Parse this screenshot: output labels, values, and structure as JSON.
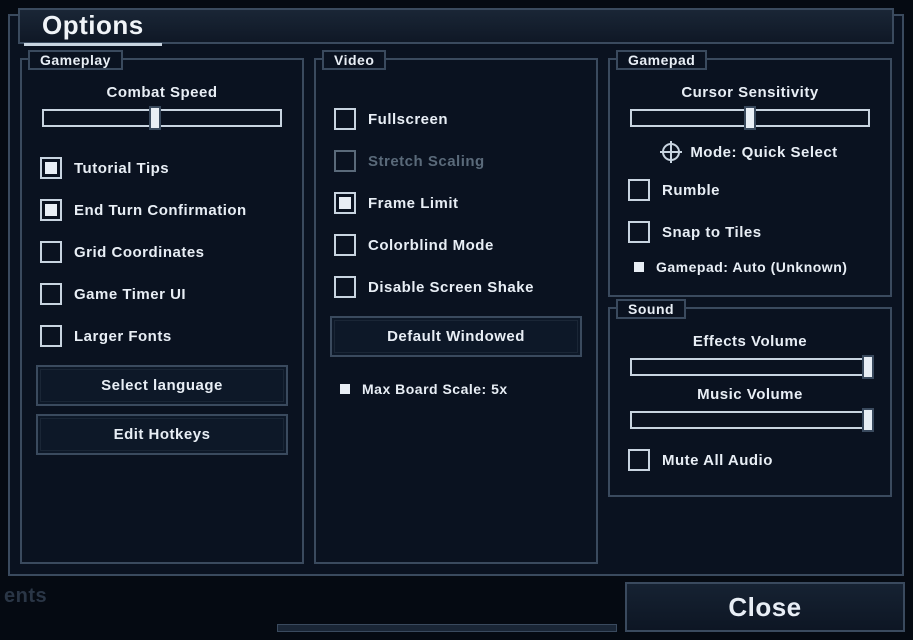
{
  "title": "Options",
  "gameplay": {
    "legend": "Gameplay",
    "combat_speed": {
      "label": "Combat Speed",
      "value": 47
    },
    "tutorial_tips": {
      "label": "Tutorial Tips",
      "checked": true
    },
    "end_turn_confirm": {
      "label": "End Turn Confirmation",
      "checked": true
    },
    "grid_coords": {
      "label": "Grid Coordinates",
      "checked": false
    },
    "game_timer": {
      "label": "Game Timer UI",
      "checked": false
    },
    "larger_fonts": {
      "label": "Larger Fonts",
      "checked": false
    },
    "select_language": "Select language",
    "edit_hotkeys": "Edit Hotkeys"
  },
  "video": {
    "legend": "Video",
    "fullscreen": {
      "label": "Fullscreen",
      "checked": false
    },
    "stretch": {
      "label": "Stretch Scaling",
      "checked": false,
      "enabled": false
    },
    "frame_limit": {
      "label": "Frame Limit",
      "checked": true
    },
    "colorblind": {
      "label": "Colorblind Mode",
      "checked": false
    },
    "disable_shake": {
      "label": "Disable Screen Shake",
      "checked": false
    },
    "default_windowed": "Default Windowed",
    "max_board_scale": "Max Board Scale: 5x"
  },
  "gamepad": {
    "legend": "Gamepad",
    "cursor_sensitivity": {
      "label": "Cursor Sensitivity",
      "value": 50
    },
    "mode": "Mode: Quick Select",
    "rumble": {
      "label": "Rumble",
      "checked": false
    },
    "snap_tiles": {
      "label": "Snap to Tiles",
      "checked": false
    },
    "device": "Gamepad: Auto (Unknown)"
  },
  "sound": {
    "legend": "Sound",
    "effects": {
      "label": "Effects Volume",
      "value": 100
    },
    "music": {
      "label": "Music Volume",
      "value": 100
    },
    "mute": {
      "label": "Mute All Audio",
      "checked": false
    }
  },
  "close": "Close",
  "bg_fragment": "ents"
}
